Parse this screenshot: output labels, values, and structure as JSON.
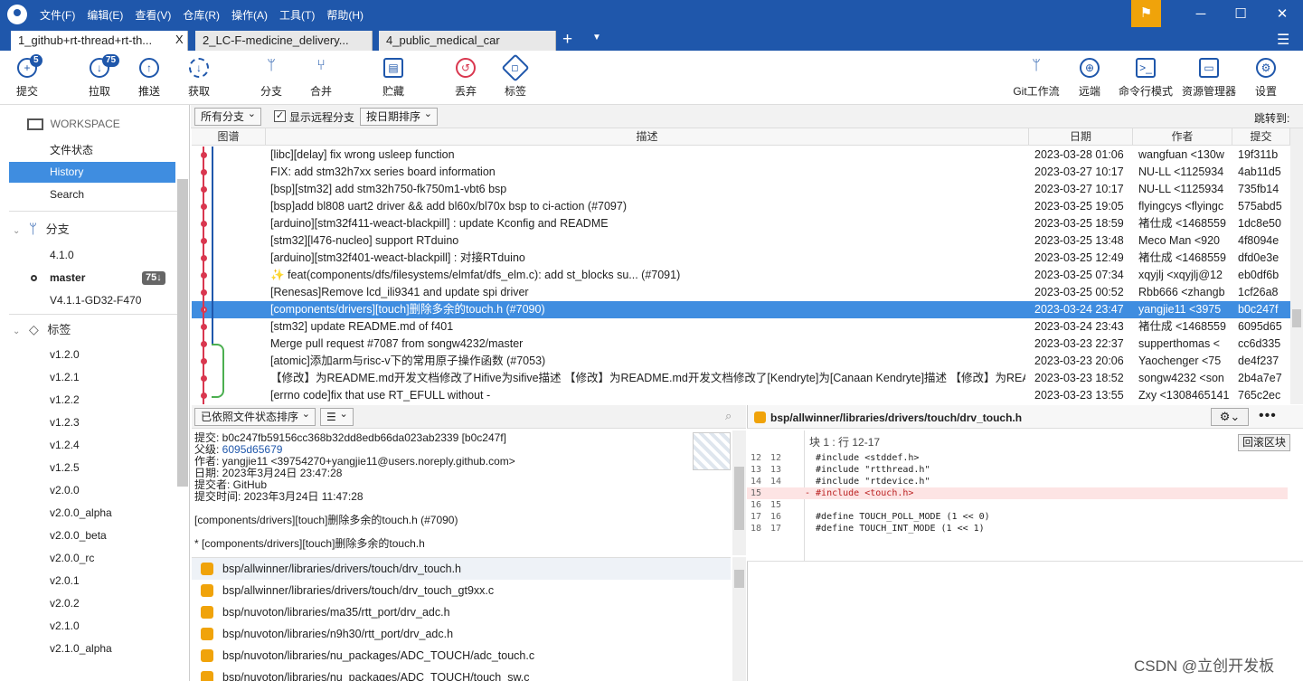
{
  "menu": [
    "文件(F)",
    "编辑(E)",
    "查看(V)",
    "仓库(R)",
    "操作(A)",
    "工具(T)",
    "帮助(H)"
  ],
  "tabs": [
    "1_github+rt-thread+rt-th...",
    "2_LC-F-medicine_delivery...",
    "4_public_medical_car"
  ],
  "tab_close": "X",
  "toolbar": {
    "commit": "提交",
    "commit_badge": "5",
    "pull": "拉取",
    "pull_badge": "75",
    "push": "推送",
    "fetch": "获取",
    "branch": "分支",
    "merge": "合并",
    "stash": "贮藏",
    "discard": "丢弃",
    "tag": "标签",
    "gitflow": "Git工作流",
    "remote": "远端",
    "terminal": "命令行模式",
    "explorer": "资源管理器",
    "settings": "设置"
  },
  "sidebar": {
    "workspace": "WORKSPACE",
    "file_status": "文件状态",
    "history": "History",
    "search": "Search",
    "branches_label": "分支",
    "branches": [
      "4.1.0",
      "master",
      "V4.1.1-GD32-F470"
    ],
    "master_badge": "75↓",
    "tags_label": "标签",
    "tags": [
      "v1.2.0",
      "v1.2.1",
      "v1.2.2",
      "v1.2.3",
      "v1.2.4",
      "v1.2.5",
      "v2.0.0",
      "v2.0.0_alpha",
      "v2.0.0_beta",
      "v2.0.0_rc",
      "v2.0.1",
      "v2.0.2",
      "v2.1.0",
      "v2.1.0_alpha"
    ]
  },
  "filter": {
    "all_branches": "所有分支",
    "show_remote": "显示远程分支",
    "sort_by_date": "按日期排序",
    "jump_to": "跳转到:"
  },
  "columns": {
    "graph": "图谱",
    "desc": "描述",
    "date": "日期",
    "author": "作者",
    "commit": "提交"
  },
  "commits": [
    {
      "desc": "[libc][delay] fix wrong usleep function",
      "date": "2023-03-28 01:06",
      "author": "wangfuan <130w",
      "hash": "19f311b"
    },
    {
      "desc": "FIX: add stm32h7xx series board information",
      "date": "2023-03-27 10:17",
      "author": "NU-LL <1125934",
      "hash": "4ab11d5"
    },
    {
      "desc": "[bsp][stm32] add stm32h750-fk750m1-vbt6 bsp",
      "date": "2023-03-27 10:17",
      "author": "NU-LL <1125934",
      "hash": "735fb14"
    },
    {
      "desc": "[bsp]add bl808 uart2 driver && add bl60x/bl70x bsp to ci-action (#7097)",
      "date": "2023-03-25 19:05",
      "author": "flyingcys <flyingc",
      "hash": "575abd5"
    },
    {
      "desc": "[arduino][stm32f411-weact-blackpill] : update Kconfig and README",
      "date": "2023-03-25 18:59",
      "author": "褚仕成 <1468559",
      "hash": "1dc8e50"
    },
    {
      "desc": "[stm32][l476-nucleo] support RTduino",
      "date": "2023-03-25 13:48",
      "author": "Meco Man <920",
      "hash": "4f8094e"
    },
    {
      "desc": "[arduino][stm32f401-weact-blackpill] : 对接RTduino",
      "date": "2023-03-25 12:49",
      "author": "褚仕成 <1468559",
      "hash": "dfd0e3e"
    },
    {
      "desc": "✨ feat(components/dfs/filesystems/elmfat/dfs_elm.c): add st_blocks su... (#7091)",
      "date": "2023-03-25 07:34",
      "author": "xqyjlj <xqyjlj@12",
      "hash": "eb0df6b"
    },
    {
      "desc": "[Renesas]Remove lcd_ili9341 and update spi driver",
      "date": "2023-03-25 00:52",
      "author": "Rbb666 <zhangb",
      "hash": "1cf26a8"
    },
    {
      "desc": "[components/drivers][touch]删除多余的touch.h (#7090)",
      "date": "2023-03-24 23:47",
      "author": "yangjie11 <3975",
      "hash": "b0c247f"
    },
    {
      "desc": "[stm32] update README.md of f401",
      "date": "2023-03-24 23:43",
      "author": "褚仕成 <1468559",
      "hash": "6095d65"
    },
    {
      "desc": "Merge pull request #7087 from songw4232/master",
      "date": "2023-03-23 22:37",
      "author": "supperthomas <",
      "hash": "cc6d335"
    },
    {
      "desc": "[atomic]添加arm与risc-v下的常用原子操作函数 (#7053)",
      "date": "2023-03-23 20:06",
      "author": "Yaochenger <75",
      "hash": "de4f237"
    },
    {
      "desc": "【修改】为README.md开发文档修改了Hifive为sifive描述 【修改】为README.md开发文档修改了[Kendryte]为[Canaan Kendryte]描述 【修改】为README",
      "date": "2023-03-23 18:52",
      "author": "songw4232 <son",
      "hash": "2b4a7e7"
    },
    {
      "desc": "[errno code]fix that use RT_EFULL without -",
      "date": "2023-03-23 13:55",
      "author": "Zxy <1308465141",
      "hash": "765c2ec"
    }
  ],
  "sortbar": {
    "file_sort": "已依照文件状态排序",
    "view": "☰"
  },
  "detail": {
    "commit_line": "提交: b0c247fb59156cc368b32dd8edb66da023ab2339 [b0c247f]",
    "parent_label": "父级: ",
    "parent": "6095d65679",
    "author": "作者: yangjie11 <39754270+yangjie11@users.noreply.github.com>",
    "date": "日期: 2023年3月24日 23:47:28",
    "committer": "提交者: GitHub",
    "commit_time": "提交时间: 2023年3月24日 11:47:28",
    "message": "[components/drivers][touch]删除多余的touch.h (#7090)",
    "message2": "* [components/drivers][touch]删除多余的touch.h"
  },
  "files": [
    "bsp/allwinner/libraries/drivers/touch/drv_touch.h",
    "bsp/allwinner/libraries/drivers/touch/drv_touch_gt9xx.c",
    "bsp/nuvoton/libraries/ma35/rtt_port/drv_adc.h",
    "bsp/nuvoton/libraries/n9h30/rtt_port/drv_adc.h",
    "bsp/nuvoton/libraries/nu_packages/ADC_TOUCH/adc_touch.c",
    "bsp/nuvoton/libraries/nu_packages/ADC_TOUCH/touch_sw.c"
  ],
  "diff": {
    "path": "bsp/allwinner/libraries/drivers/touch/drv_touch.h",
    "hunk": "块 1 : 行 12-17",
    "revert": "回滚区块",
    "old_nums": [
      "12",
      "13",
      "14",
      "15",
      "16",
      "17",
      "18"
    ],
    "new_nums": [
      "12",
      "13",
      "14",
      "",
      "15",
      "16",
      "17"
    ],
    "lines": [
      "  #include <stddef.h>",
      "  #include \"rtthread.h\"",
      "  #include \"rtdevice.h\"",
      "- #include <touch.h>",
      "  ",
      "  #define TOUCH_POLL_MODE (1 << 0)",
      "  #define TOUCH_INT_MODE (1 << 1)"
    ]
  },
  "watermark": "CSDN @立创开发板"
}
